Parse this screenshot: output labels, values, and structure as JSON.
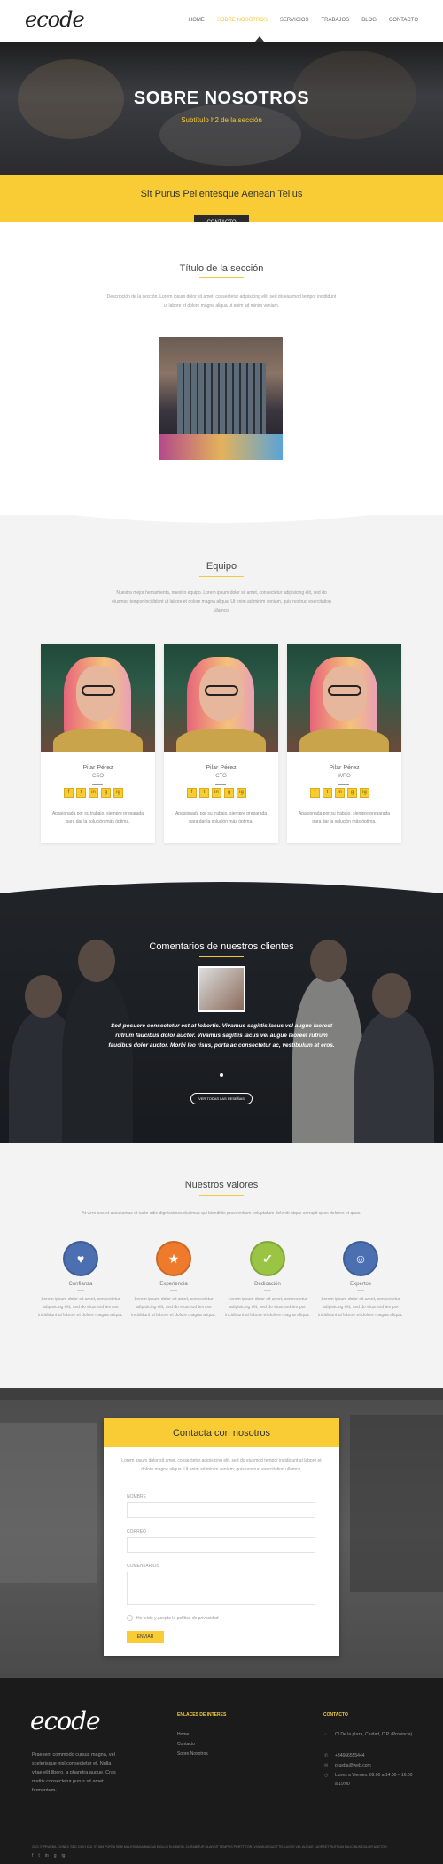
{
  "header": {
    "logo": "ecode",
    "nav": [
      "HOME",
      "SOBRE NOSOTROS",
      "SERVICIOS",
      "TRABAJOS",
      "BLOG",
      "CONTACTO"
    ],
    "active_index": 1
  },
  "hero": {
    "title": "SOBRE NOSOTROS",
    "subtitle": "Subtítulo h2 de la sección"
  },
  "band": {
    "title": "Sit Purus Pellentesque Aenean Tellus",
    "button": "CONTACTO"
  },
  "section1": {
    "title": "Título de la sección",
    "description": "Descripción de la sección. Lorem ipsum dolor sit amet, consectetur adipisicing elit, sed do eiusmod tempor incididunt ut labore et dolore magna aliqua ut enim ad minim veniam."
  },
  "team": {
    "title": "Equipo",
    "description": "Nuestra mejor herramienta, nuestro equipo. Lorem ipsum dolor sit amet, consectetur adipisicing elit, sed do eiusmod tempor incididunt ut labore et dolore magna aliqua. Ut enim ad minim veniam, quis nostrud exercitation ullamco.",
    "members": [
      {
        "name": "Pilar Pérez",
        "role": "CEO",
        "bio": "Apasionada por su trabajo, siempre preparada para dar la solución más óptima."
      },
      {
        "name": "Pilar Pérez",
        "role": "CTO",
        "bio": "Apasionada por su trabajo, siempre preparada para dar la solución más óptima."
      },
      {
        "name": "Pilar Pérez",
        "role": "WPO",
        "bio": "Apasionada por su trabajo, siempre preparada para dar la solución más óptima."
      }
    ],
    "social_icons": [
      "f",
      "t",
      "in",
      "g",
      "ig"
    ]
  },
  "testimonials": {
    "title": "Comentarios de nuestros clientes",
    "quote": "Sed posuere consectetur est at lobortis. Vivamus sagittis lacus vel augue laoreet rutrum faucibus dolor auctor. Vivamus sagittis lacus vel augue laoreet rutrum faucibus dolor auctor. Morbi leo risus, porta ac consectetur ac, vestibulum at eros.",
    "button": "VER TODAS LAS RESEÑAS"
  },
  "values": {
    "title": "Nuestros valores",
    "description": "At vero eos et accusamus et iusto odio dignissimos ducimus qui blanditiis praesentium voluptatum deleniti atque corrupti quos dolores et quas.",
    "items": [
      {
        "title": "Confianza",
        "color": "#4b6fb0",
        "icon": "♥",
        "text": "Lorem ipsum dolor sit amet, consectetur adipisicing elit, sed do eiusmod tempor incididunt ut labore et dolore magna aliqua."
      },
      {
        "title": "Experiencia",
        "color": "#f07a2c",
        "icon": "★",
        "text": "Lorem ipsum dolor sit amet, consectetur adipisicing elit, sed do eiusmod tempor incididunt ut labore et dolore magna aliqua."
      },
      {
        "title": "Dedicación",
        "color": "#9ac444",
        "icon": "✔",
        "text": "Lorem ipsum dolor sit amet, consectetur adipisicing elit, sed do eiusmod tempor incididunt ut labore et dolore magna aliqua."
      },
      {
        "title": "Expertos",
        "color": "#4b6fb0",
        "icon": "☺",
        "text": "Lorem ipsum dolor sit amet, consectetur adipisicing elit, sed do eiusmod tempor incididunt ut labore et dolore magna aliqua."
      }
    ]
  },
  "contact": {
    "title": "Contacta con nosotros",
    "description": "Lorem ipsum dolor sit amet, consectetur adipisicing elit, sed do eiusmod tempor incididunt ut labore et dolore magna aliqua. Ut enim ad minim veniam, quis nostrud exercitation ullamco.",
    "name_label": "NOMBRE",
    "email_label": "CORREO",
    "comments_label": "COMENTARIOS",
    "privacy_label": "He leído y acepto la política de privacidad",
    "send_button": "ENVIAR"
  },
  "footer": {
    "logo": "ecode",
    "about": "Praesent commodo cursus magna, vel scelerisque nisl consectetur et. Nulla vitae elit libero, a pharetra augue. Cras mattis consectetur purus sit amet fermentum.",
    "links_title": "ENLACES DE INTERÉS",
    "links": [
      "Home",
      "Contacto",
      "Sobre Nosotros"
    ],
    "contact_title": "CONTACTO",
    "address": "C/ De la plaza, Ciudad, C.P. (Provincia)",
    "phone": "+34666555444",
    "email": "prueba@web.com",
    "hours": "Lunes a Viernes: 09:00 a 14:00 – 16:00 a 19:00",
    "copyright": "2021 © PRUEBA. DONEC SED ODIO DUI. ETIAM PORTA SEM MALESUADA MAGNA MOLLIS EUISMOD. CURABITUR BLANDIT TEMPUS PORTTITOR. VIVAMUS SAGITTIS LACUS VEL AUGUE LAOREET RUTRUM FAUCIBUS DOLOR AUCTOR.",
    "social": [
      "f",
      "t",
      "in",
      "g",
      "ig"
    ]
  }
}
